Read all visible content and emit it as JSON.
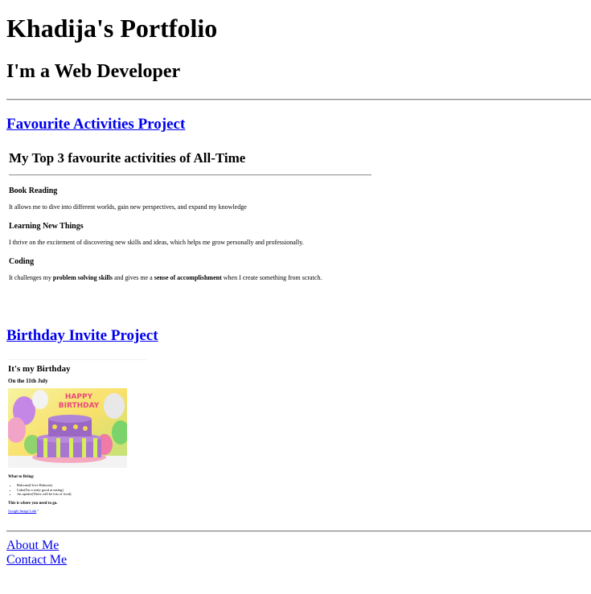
{
  "header": {
    "title": "Khadija's Portfolio",
    "subtitle": "I'm a Web Developer"
  },
  "projects": [
    {
      "link_label": "Favourite Activities Project",
      "heading": "My Top 3 favourite activities of All-Time",
      "items": [
        {
          "name": "Book Reading",
          "text": "It allows me to dive into different worlds, gain new perspectives, and expand my knowledge"
        },
        {
          "name": "Learning New Things",
          "text": "I thrive on the excitement of discovering new skills and ideas, which helps me grow personally and professionally."
        },
        {
          "name": "Coding",
          "text_before": "It challenges my ",
          "bold1": "problem solving skills",
          "text_mid": " and gives me a ",
          "bold2": "sense of accomplishment",
          "text_after": " when I create something from scratch."
        }
      ]
    },
    {
      "link_label": "Birthday Invite Project",
      "heading": "It's my Birthday",
      "date": "On the 11th July",
      "bring_label": "What to Bring:",
      "bring_items": [
        "Baloons(I love Baloons)",
        "Cake(I'm a realy good at eating)",
        "An apetite(There will be lots of food)"
      ],
      "where_label": "This is where you need to go.",
      "google_link": "Google Image Link",
      "cake_topper": "HAPPY BIRTHDAY"
    }
  ],
  "footer": {
    "about": "About Me",
    "contact": "Contact Me"
  },
  "colors": {
    "link": "#0000EE",
    "rule": "#888888"
  }
}
